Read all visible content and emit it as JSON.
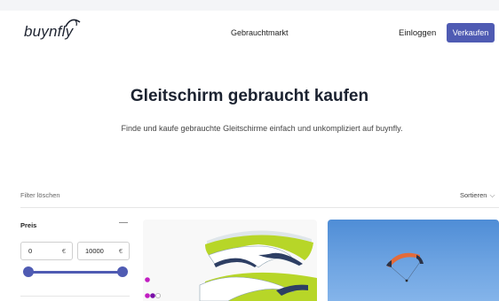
{
  "header": {
    "logo_text": "buynfly",
    "nav_market": "Gebrauchtmarkt",
    "login_label": "Einloggen",
    "sell_label": "Verkaufen",
    "accent_color": "#4f5bb3"
  },
  "hero": {
    "title": "Gleitschirm gebraucht kaufen",
    "subtitle": "Finde und kaufe gebrauchte Gleitschirme einfach und unkompliziert auf buynfly."
  },
  "toolbar": {
    "filter_clear": "Filter löschen",
    "sort_label": "Sortieren"
  },
  "filters": {
    "price": {
      "label": "Preis",
      "collapse_symbol": "—",
      "min_value": "0",
      "max_value": "10000",
      "currency": "€",
      "range_min_fraction": 0,
      "range_max_fraction": 1
    }
  },
  "listings": [
    {
      "image": "paraglider-wing-green-white",
      "color_options": [
        "#c21ec2",
        "#7a0fa8",
        "#ffffff"
      ]
    },
    {
      "image": "paraglider-in-blue-sky"
    }
  ]
}
